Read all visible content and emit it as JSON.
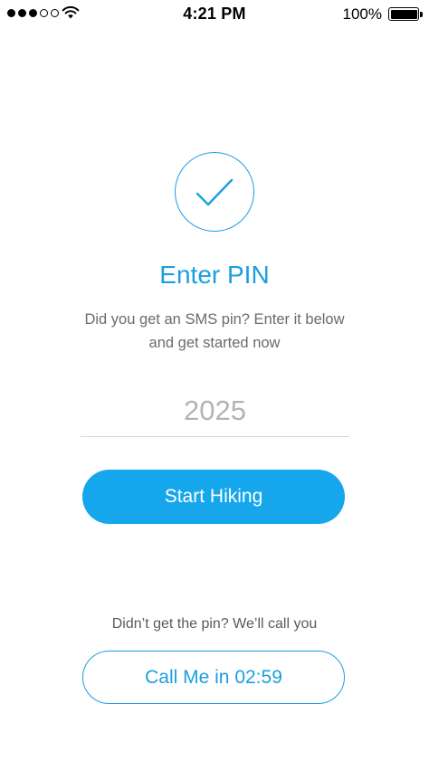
{
  "status_bar": {
    "time": "4:21 PM",
    "battery_percent": "100%",
    "signal_bars_filled": 3,
    "signal_bars_total": 5
  },
  "icons": {
    "check": "check-icon",
    "wifi": "wifi-icon",
    "battery": "battery-icon"
  },
  "title": "Enter PIN",
  "subtitle_line1": "Did you get an SMS pin? Enter it below",
  "subtitle_line2": "and get started now",
  "pin_input": {
    "placeholder": "2025",
    "value": ""
  },
  "start_button_label": "Start Hiking",
  "call_hint": "Didn’t get the pin? We’ll call you",
  "call_button_label": "Call Me in 02:59",
  "colors": {
    "accent": "#1a9fe0",
    "primary_button": "#15a6ec",
    "body_text": "#6b6b6b",
    "placeholder": "#b3b3b3"
  }
}
